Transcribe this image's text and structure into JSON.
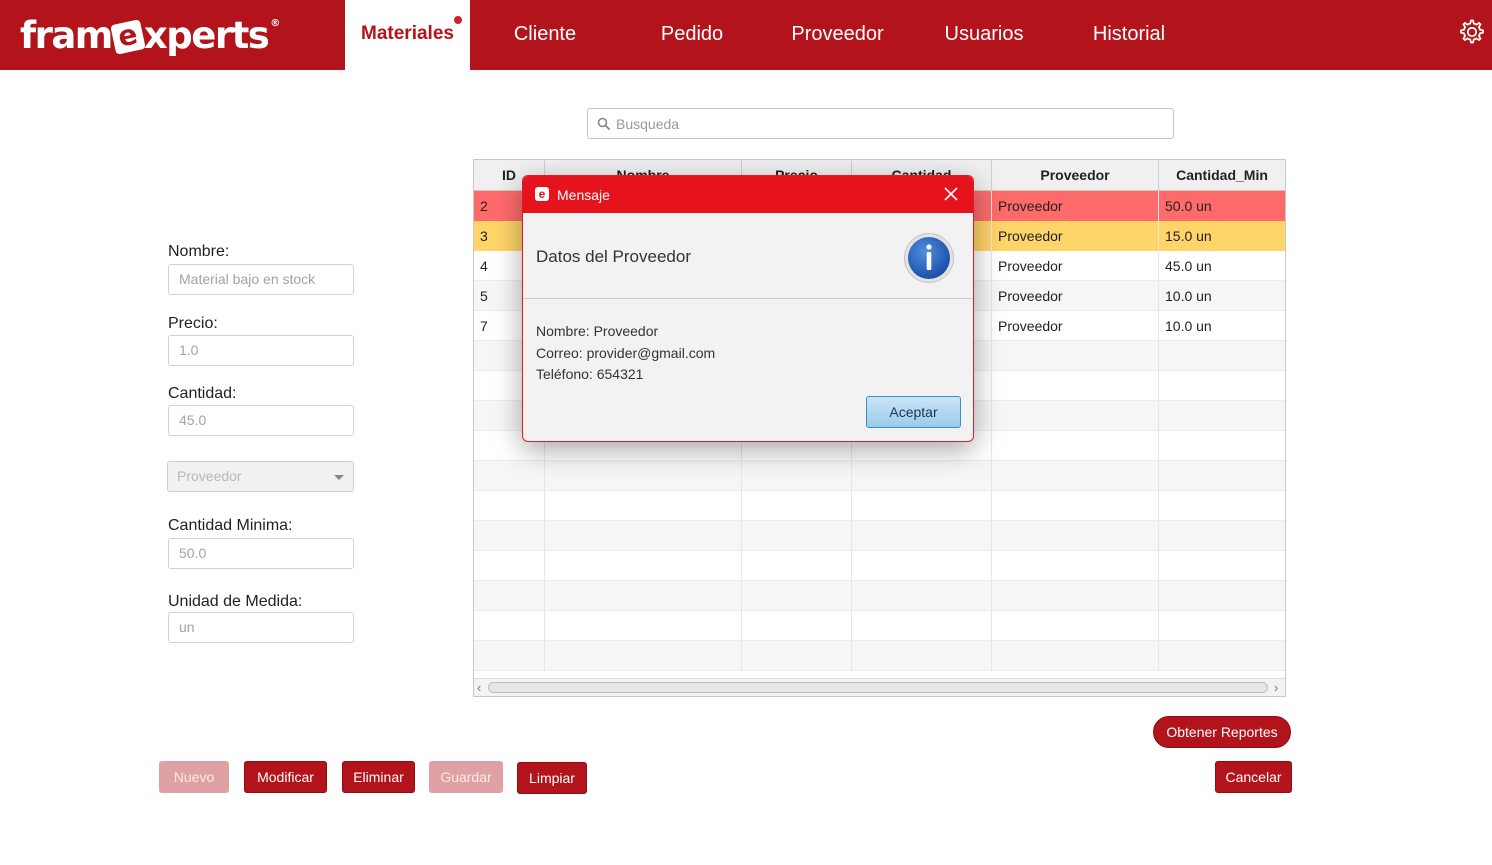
{
  "app": {
    "logo_left": "fram",
    "logo_badge": "e",
    "logo_right": "xperts",
    "logo_reg": "®"
  },
  "nav": {
    "tabs": [
      "Materiales",
      "Cliente",
      "Pedido",
      "Proveedor",
      "Usuarios",
      "Historial"
    ],
    "active": "Materiales",
    "settings_icon": "gear-icon"
  },
  "search": {
    "placeholder": "Busqueda",
    "icon": "search-icon"
  },
  "form": {
    "nombre_label": "Nombre:",
    "nombre_placeholder": "Material bajo en stock",
    "precio_label": "Precio:",
    "precio_value": "1.0",
    "cantidad_label": "Cantidad:",
    "cantidad_value": "45.0",
    "proveedor_placeholder": "Proveedor",
    "cantidad_min_label": "Cantidad Minima:",
    "cantidad_min_value": "50.0",
    "unidad_label": "Unidad de Medida:",
    "unidad_value": "un"
  },
  "table": {
    "headers": [
      "ID",
      "Nombre",
      "Precio",
      "Cantidad",
      "Proveedor",
      "Cantidad_Min"
    ],
    "rows": [
      {
        "id": "2",
        "proveedor": "Proveedor",
        "cantidad_min": "50.0 un",
        "status": "critical"
      },
      {
        "id": "3",
        "proveedor": "Proveedor",
        "cantidad_min": "15.0 un",
        "status": "warning"
      },
      {
        "id": "4",
        "proveedor": "Proveedor",
        "cantidad_min": "45.0 un",
        "status": "normal"
      },
      {
        "id": "5",
        "proveedor": "Proveedor",
        "cantidad_min": "10.0 un",
        "status": "normal"
      },
      {
        "id": "7",
        "proveedor": "Proveedor",
        "cantidad_min": "10.0 un",
        "status": "normal"
      }
    ],
    "status_colors": {
      "critical": "#ff6b6b",
      "warning": "#ffd469",
      "normal": "#ffffff",
      "alt": "#f6f6f6"
    }
  },
  "actions": {
    "nuevo": "Nuevo",
    "modificar": "Modificar",
    "eliminar": "Eliminar",
    "guardar": "Guardar",
    "limpiar": "Limpiar",
    "reportes": "Obtener Reportes",
    "cancelar": "Cancelar"
  },
  "dialog": {
    "app_icon": "e",
    "title": "Mensaje",
    "heading": "Datos del Proveedor",
    "line1": "Nombre: Proveedor",
    "line2": "Correo: provider@gmail.com",
    "line3": "Teléfono: 654321",
    "ok_label": "Aceptar",
    "icon": "info-icon"
  },
  "colors": {
    "brand": "#b3141b",
    "dialog_title": "#e6131d"
  }
}
